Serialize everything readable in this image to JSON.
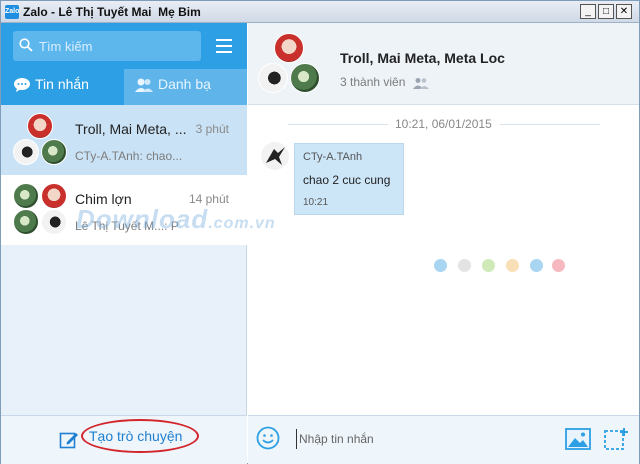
{
  "window": {
    "title": "Zalo - Lê Thị Tuyết Mai  Mẹ Bim",
    "app_icon": "Zalo",
    "controls": {
      "minimize": "_",
      "maximize": "□",
      "close": "✕"
    }
  },
  "sidebar": {
    "search": {
      "placeholder": "Tìm kiếm",
      "value": ""
    },
    "tabs": [
      {
        "label": "Tin nhắn",
        "icon": "chat-bubble-icon",
        "active": true
      },
      {
        "label": "Danh bạ",
        "icon": "contacts-icon",
        "active": false
      }
    ],
    "conversations": [
      {
        "name": "Troll, Mai Meta, ...",
        "time": "3 phút",
        "preview": "CTy-A.TAnh: chao...",
        "active": true
      },
      {
        "name": "Chim lợn",
        "time": "14 phút",
        "preview": "Lê Thị Tuyết M...: P",
        "active": false
      }
    ],
    "footer": {
      "create_label": "Tạo trò chuyện"
    }
  },
  "chat": {
    "title": "Troll, Mai Meta, Meta Loc",
    "members": "3 thành viên",
    "date_separator": "10:21, 06/01/2015",
    "messages": [
      {
        "sender": "CTy-A.TAnh",
        "text": "chao 2 cuc cung",
        "time": "10:21"
      }
    ],
    "composer": {
      "placeholder": "Nhập tin nhắn",
      "value": ""
    }
  },
  "watermark": {
    "text": "Download",
    "suffix": ".com.vn"
  },
  "colors": {
    "accent": "#2d9fe4",
    "bubble": "#cce6f8",
    "highlight_oval": "#d2262b",
    "typing_dots": [
      "#a9d4f2",
      "#e3e3e3",
      "#cfe9b8",
      "#f8dfb6",
      "#a9d4f2",
      "#f6b9c0"
    ]
  }
}
